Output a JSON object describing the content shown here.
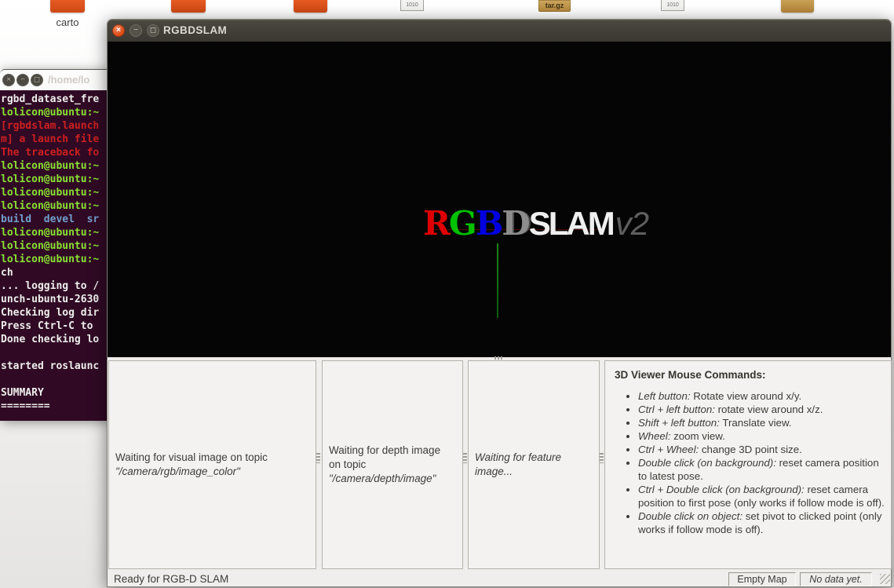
{
  "desktop": {
    "icons": {
      "carto_label": "carto",
      "targz_label": "tar.gz",
      "file1010a_label": "1010",
      "file1010b_label": "1010"
    }
  },
  "terminal": {
    "title": "/home/lo",
    "buttons": {
      "close": "×",
      "min": "−",
      "max": "◻"
    },
    "lines": [
      "rgbd_dataset_fre",
      "lolicon@ubuntu:~",
      "[rgbdslam.launch",
      "m] a launch file",
      "The traceback fo",
      "lolicon@ubuntu:~",
      "lolicon@ubuntu:~",
      "lolicon@ubuntu:~",
      "lolicon@ubuntu:~",
      "build  devel  sr",
      "lolicon@ubuntu:~",
      "lolicon@ubuntu:~",
      "lolicon@ubuntu:~",
      "ch",
      "... logging to /",
      "unch-ubuntu-2630",
      "Checking log dir",
      "Press Ctrl-C to ",
      "Done checking lo",
      "",
      "started roslaunc",
      "",
      "SUMMARY",
      "========"
    ]
  },
  "window": {
    "title": "RGBDSLAM",
    "buttons": {
      "close": "×",
      "min": "−",
      "max": "◻"
    },
    "logo": {
      "r": "R",
      "g": "G",
      "b": "B",
      "d": "D",
      "slam": "SLAM",
      "version": "v2"
    },
    "viewer_panels": {
      "visual": {
        "normal": "Waiting for visual image on topic",
        "italic": "\"/camera/rgb/image_color\""
      },
      "depth": {
        "normal": "Waiting for depth image on topic",
        "italic": "\"/camera/depth/image\""
      },
      "feature": {
        "italic": "Waiting for feature image..."
      }
    },
    "mouse_commands": {
      "title": "3D Viewer Mouse Commands:",
      "items": [
        {
          "key": "Left button:",
          "desc": " Rotate view around x/y."
        },
        {
          "key": "Ctrl + left button:",
          "desc": " rotate view around x/z."
        },
        {
          "key": "Shift + left button:",
          "desc": " Translate view."
        },
        {
          "key": "Wheel:",
          "desc": " zoom view."
        },
        {
          "key": "Ctrl + Wheel:",
          "desc": " change 3D point size."
        },
        {
          "key": "Double click (on background):",
          "desc": " reset camera position to latest pose."
        },
        {
          "key": "Ctrl + Double click (on background):",
          "desc": " reset camera position to first pose (only works if follow mode is off)."
        },
        {
          "key": "Double click on object:",
          "desc": " set pivot to clicked point (only works if follow mode is off)."
        }
      ]
    },
    "statusbar": {
      "ready": "Ready for RGB-D SLAM",
      "map_status": "Empty Map",
      "data_status": "No data yet."
    },
    "colors": {
      "accent_orange": "#dd4814",
      "terminal_bg": "#300a24",
      "prompt_green": "#8ae234",
      "error_red": "#cc2020",
      "dir_blue": "#729fcf",
      "logo_red": "#e00000",
      "logo_green": "#00c000",
      "logo_blue": "#0000e0"
    }
  }
}
